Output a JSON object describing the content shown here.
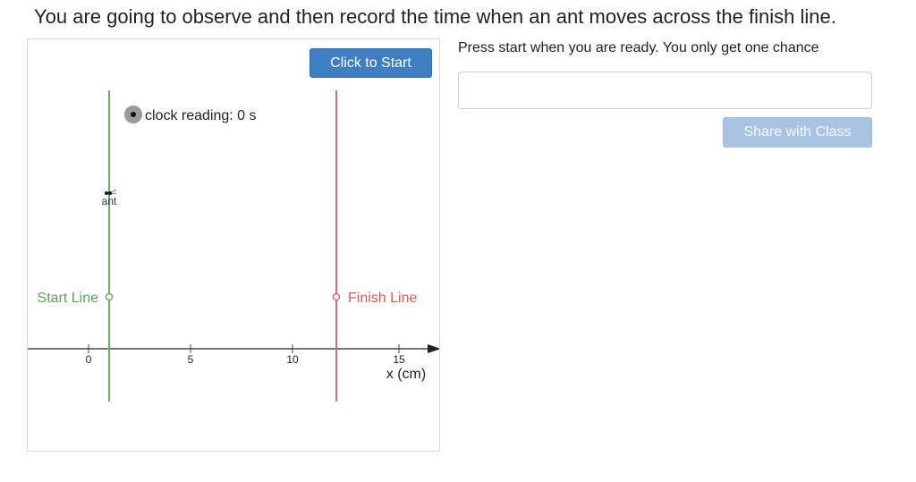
{
  "instruction": "You are going to observe and then record the time when an ant moves across the finish line.",
  "simulation": {
    "start_button_label": "Click to Start",
    "clock_label": "clock reading: 0 s",
    "ant_label": "ant",
    "start_line_label": "Start Line",
    "finish_line_label": "Finish Line",
    "axis_label": "x (cm)",
    "ticks": [
      "0",
      "5",
      "10",
      "15"
    ],
    "colors": {
      "start_line": "#6aaa6a",
      "finish_line": "#d96a6a",
      "button": "#3f7fc1"
    }
  },
  "response": {
    "prompt": "Press start when you are ready. You only get one chance",
    "input_value": "",
    "input_placeholder": "",
    "share_button_label": "Share with Class"
  }
}
